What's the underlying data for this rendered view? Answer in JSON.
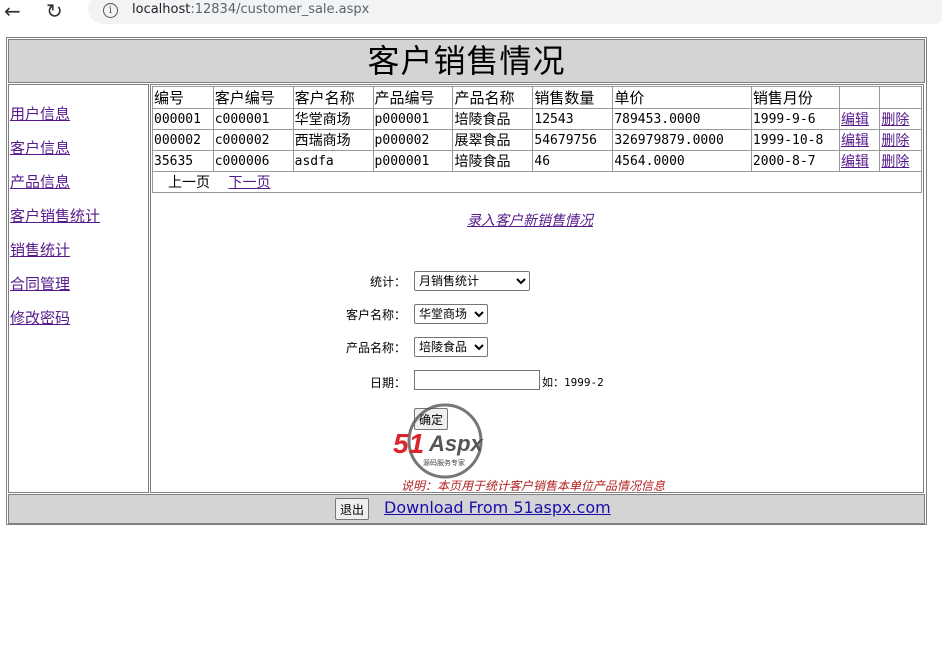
{
  "browser": {
    "url_host": "localhost",
    "url_rest": ":12834/customer_sale.aspx"
  },
  "page": {
    "title": "客户销售情况"
  },
  "sidebar": {
    "items": [
      {
        "label": "用户信息"
      },
      {
        "label": "客户信息"
      },
      {
        "label": "产品信息"
      },
      {
        "label": "客户销售统计"
      },
      {
        "label": "销售统计"
      },
      {
        "label": "合同管理"
      },
      {
        "label": "修改密码"
      }
    ]
  },
  "table": {
    "headers": [
      "编号",
      "客户编号",
      "客户名称",
      "产品编号",
      "产品名称",
      "销售数量",
      "单价",
      "销售月份",
      "",
      ""
    ],
    "rows": [
      {
        "id": "000001",
        "customer_id": "c000001",
        "customer_name": "华堂商场",
        "product_id": "p000001",
        "product_name": "培陵食品",
        "quantity": "12543",
        "price": "789453.0000",
        "month": "1999-9-6",
        "edit": "编辑",
        "delete": "删除"
      },
      {
        "id": "000002",
        "customer_id": "c000002",
        "customer_name": "西瑞商场",
        "product_id": "p000002",
        "product_name": "展翠食品",
        "quantity": "54679756",
        "price": "326979879.0000",
        "month": "1999-10-8",
        "edit": "编辑",
        "delete": "删除"
      },
      {
        "id": "35635",
        "customer_id": "c000006",
        "customer_name": "asdfa",
        "product_id": "p000001",
        "product_name": "培陵食品",
        "quantity": "46",
        "price": "4564.0000",
        "month": "2000-8-7",
        "edit": "编辑",
        "delete": "删除"
      }
    ],
    "prev_page": "上一页",
    "next_page": "下一页"
  },
  "form": {
    "new_link": "录入客户新销售情况",
    "stat_label": "统计：",
    "stat_value": "月销售统计",
    "customer_label": "客户名称：",
    "customer_value": "华堂商场",
    "product_label": "产品名称：",
    "product_value": "培陵食品",
    "date_label": "日期：",
    "date_value": "",
    "date_hint": "如：1999-2",
    "confirm": "确定",
    "note": "说明：本页用于统计客户销售本单位产品情况信息"
  },
  "logo": {
    "text_51": "51",
    "text_aspx": "Aspx",
    "tagline": "源码服务专家"
  },
  "footer": {
    "exit": "退出",
    "download": "Download From 51aspx.com"
  },
  "colors": {
    "header_bg": "#d4d4d4",
    "link": "#551a8b",
    "note": "#b22222"
  }
}
